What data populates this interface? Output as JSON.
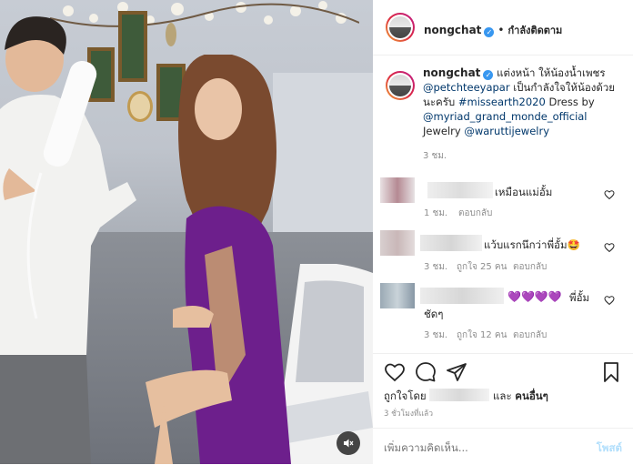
{
  "header": {
    "username": "nongchat",
    "separator": "•",
    "follow_status": "กำลังติดตาม"
  },
  "caption": {
    "username": "nongchat",
    "text_1": "แต่งหน้า ให้น้องน้ำเพชร",
    "mention_1": "@petchteeyapar",
    "text_2": "เป็นกำลังใจให้น้องด้วยนะครับ",
    "hashtag": "#missearth2020",
    "text_3": "Dress by",
    "mention_2": "@myriad_grand_monde_official",
    "text_4": "Jewelry",
    "mention_3": "@waruttijewelry",
    "time": "3 ชม."
  },
  "comments": [
    {
      "text": "เหมือนแม่อั้ม",
      "time": "1 ชม.",
      "likes": "",
      "reply": "ตอบกลับ"
    },
    {
      "text": "แว้บแรกนึกว่าพี่อั้ม🤩",
      "time": "3 ชม.",
      "likes": "ถูกใจ 25 คน",
      "reply": "ตอบกลับ"
    },
    {
      "text_hearts": "💜💜💜💜",
      "text": "พี่อั้ม",
      "text_cont": "ชัดๆ",
      "time": "3 ชม.",
      "likes": "ถูกใจ 12 คน",
      "reply": "ตอบกลับ"
    }
  ],
  "likes": {
    "prefix": "ถูกใจโดย",
    "and": "และ",
    "others": "คนอื่นๆ",
    "time_ago": "3 ชั่วโมงที่แล้ว"
  },
  "add_comment": {
    "placeholder": "เพิ่มความคิดเห็น...",
    "post": "โพสต์"
  },
  "icons": {
    "like": "heart-icon",
    "comment": "comment-icon",
    "share": "share-icon",
    "save": "bookmark-icon",
    "mute": "speaker-muted-icon"
  },
  "colors": {
    "link": "#00376b",
    "verified": "#3897f0",
    "post_button": "#b2dffc",
    "muted_text": "#8e8e8e"
  }
}
